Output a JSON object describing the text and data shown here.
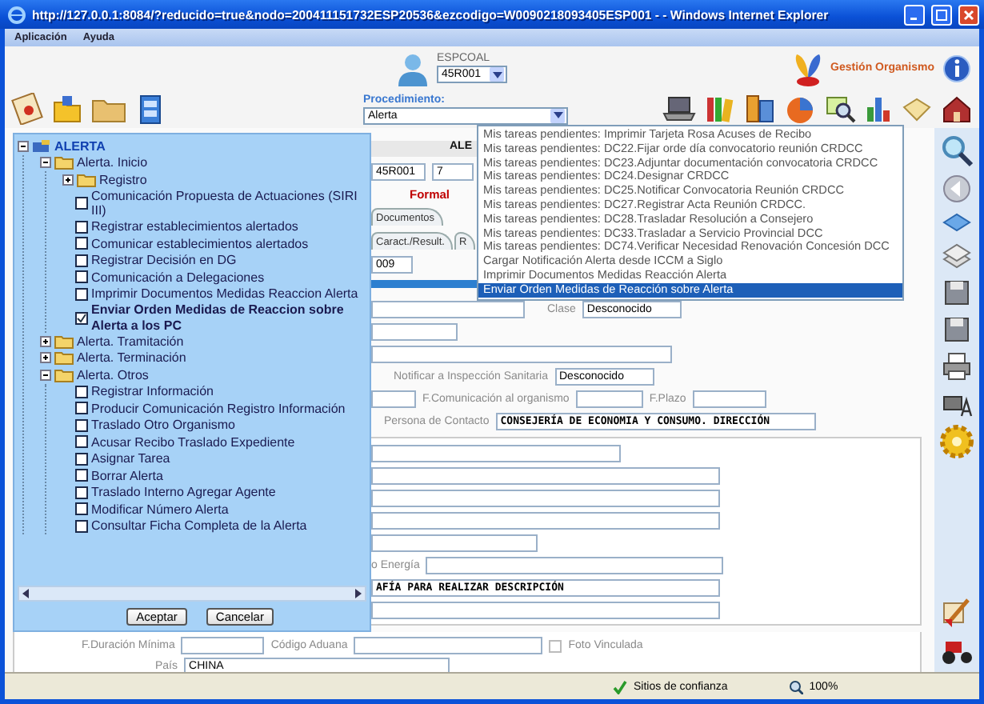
{
  "window": {
    "title": "http://127.0.0.1:8084/?reducido=true&nodo=200411151732ESP20536&ezcodigo=W0090218093405ESP001 -  - Windows Internet Explorer"
  },
  "menu": [
    "Aplicación",
    "Ayuda"
  ],
  "user": {
    "name": "ESPCOAL",
    "unit": "45R001"
  },
  "organization": "Gestión Organismo",
  "procedure": {
    "label": "Procedimiento:",
    "value": "Alerta",
    "options": [
      {
        "label": "Mis tareas pendientes: Imprimir Tarjeta Rosa Acuses de Recibo",
        "selected": false
      },
      {
        "label": "Mis tareas pendientes: DC22.Fijar orde día convocatorio reunión CRDCC",
        "selected": false
      },
      {
        "label": "Mis tareas pendientes: DC23.Adjuntar documentación convocatoria CRDCC",
        "selected": false
      },
      {
        "label": "Mis tareas pendientes: DC24.Designar CRDCC",
        "selected": false
      },
      {
        "label": "Mis tareas pendientes: DC25.Notificar Convocatoria Reunión CRDCC",
        "selected": false
      },
      {
        "label": "Mis tareas pendientes: DC27.Registrar Acta Reunión CRDCC.",
        "selected": false
      },
      {
        "label": "Mis tareas pendientes: DC28.Trasladar Resolución a Consejero",
        "selected": false
      },
      {
        "label": "Mis tareas pendientes: DC33.Trasladar a Servicio Provincial DCC",
        "selected": false
      },
      {
        "label": "Mis tareas pendientes: DC74.Verificar Necesidad Renovación Concesión DCC",
        "selected": false
      },
      {
        "label": "Cargar Notificación Alerta desde ICCM a Siglo",
        "selected": false
      },
      {
        "label": "Imprimir Documentos Medidas Reacción Alerta",
        "selected": false
      },
      {
        "label": "Enviar Orden Medidas de Reacción sobre Alerta",
        "selected": true
      }
    ]
  },
  "tree": [
    {
      "label": "ALERTA",
      "kind": "root",
      "expanded": true,
      "children": [
        {
          "label": "Alerta. Inicio",
          "kind": "folder",
          "expanded": true,
          "children": [
            {
              "label": "Registro",
              "kind": "folder",
              "expanded": false
            },
            {
              "label": "Comunicación Propuesta de Actuaciones (SIRI III)",
              "kind": "task",
              "checked": false
            },
            {
              "label": "Registrar establecimientos alertados",
              "kind": "task",
              "checked": false
            },
            {
              "label": "Comunicar establecimientos alertados",
              "kind": "task",
              "checked": false
            },
            {
              "label": "Registrar Decisión en DG",
              "kind": "task",
              "checked": false
            },
            {
              "label": "Comunicación a Delegaciones",
              "kind": "task",
              "checked": false
            },
            {
              "label": "Imprimir Documentos Medidas Reaccion Alerta",
              "kind": "task",
              "checked": false
            },
            {
              "label": "Enviar Orden Medidas de Reaccion sobre Alerta a los PC",
              "kind": "task",
              "checked": true
            }
          ]
        },
        {
          "label": "Alerta. Tramitación",
          "kind": "folder",
          "expanded": false
        },
        {
          "label": "Alerta. Terminación",
          "kind": "folder",
          "expanded": false
        },
        {
          "label": "Alerta. Otros",
          "kind": "folder",
          "expanded": true,
          "children": [
            {
              "label": "Registrar Información",
              "kind": "task",
              "checked": false
            },
            {
              "label": "Producir Comunicación Registro Información",
              "kind": "task",
              "checked": false
            },
            {
              "label": "Traslado Otro Organismo",
              "kind": "task",
              "checked": false
            },
            {
              "label": "Acusar Recibo Traslado Expediente",
              "kind": "task",
              "checked": false
            },
            {
              "label": "Asignar Tarea",
              "kind": "task",
              "checked": false
            },
            {
              "label": "Borrar Alerta",
              "kind": "task",
              "checked": false
            },
            {
              "label": "Traslado Interno Agregar Agente",
              "kind": "task",
              "checked": false
            },
            {
              "label": "Modificar Número Alerta",
              "kind": "task",
              "checked": false
            },
            {
              "label": "Consultar Ficha Completa de la Alerta",
              "kind": "task",
              "checked": false
            }
          ]
        }
      ]
    }
  ],
  "dialog_buttons": [
    "Aceptar",
    "Cancelar"
  ],
  "form": {
    "header": "ALE",
    "code_fields": [
      "45R001",
      "7"
    ],
    "section_title": "Formal",
    "tabs_upper": [
      {
        "label": "Documentos",
        "selected": false
      }
    ],
    "tabs_lower": [
      {
        "label": "Caract./Result.",
        "selected": false
      },
      {
        "label": "R",
        "selected": false
      }
    ],
    "date_fragment": "009",
    "clase": {
      "label": "Clase",
      "value": "Desconocido"
    },
    "notificar": {
      "label": "Notificar a Inspección Sanitaria",
      "value": "Desconocido"
    },
    "comunicacion": {
      "label": "F.Comunicación al organismo"
    },
    "plazo": {
      "label": "F.Plazo"
    },
    "contacto": {
      "label": "Persona de Contacto",
      "value": "CONSEJERÍA DE ECONOMIA Y CONSUMO. DIRECCIÓN"
    },
    "energia": {
      "label": "o Energía"
    },
    "descripcion": {
      "value": "AFÍA PARA REALIZAR DESCRIPCIÓN"
    },
    "duracion": {
      "label": "F.Duración Mínima"
    },
    "aduana": {
      "label": "Código Aduana"
    },
    "foto": {
      "label": "Foto Vinculada",
      "checked": false
    },
    "pais": {
      "label": "País",
      "value": "CHINA"
    }
  },
  "status_bar": {
    "zone": "Sitios de confianza",
    "zoom": "100%"
  }
}
